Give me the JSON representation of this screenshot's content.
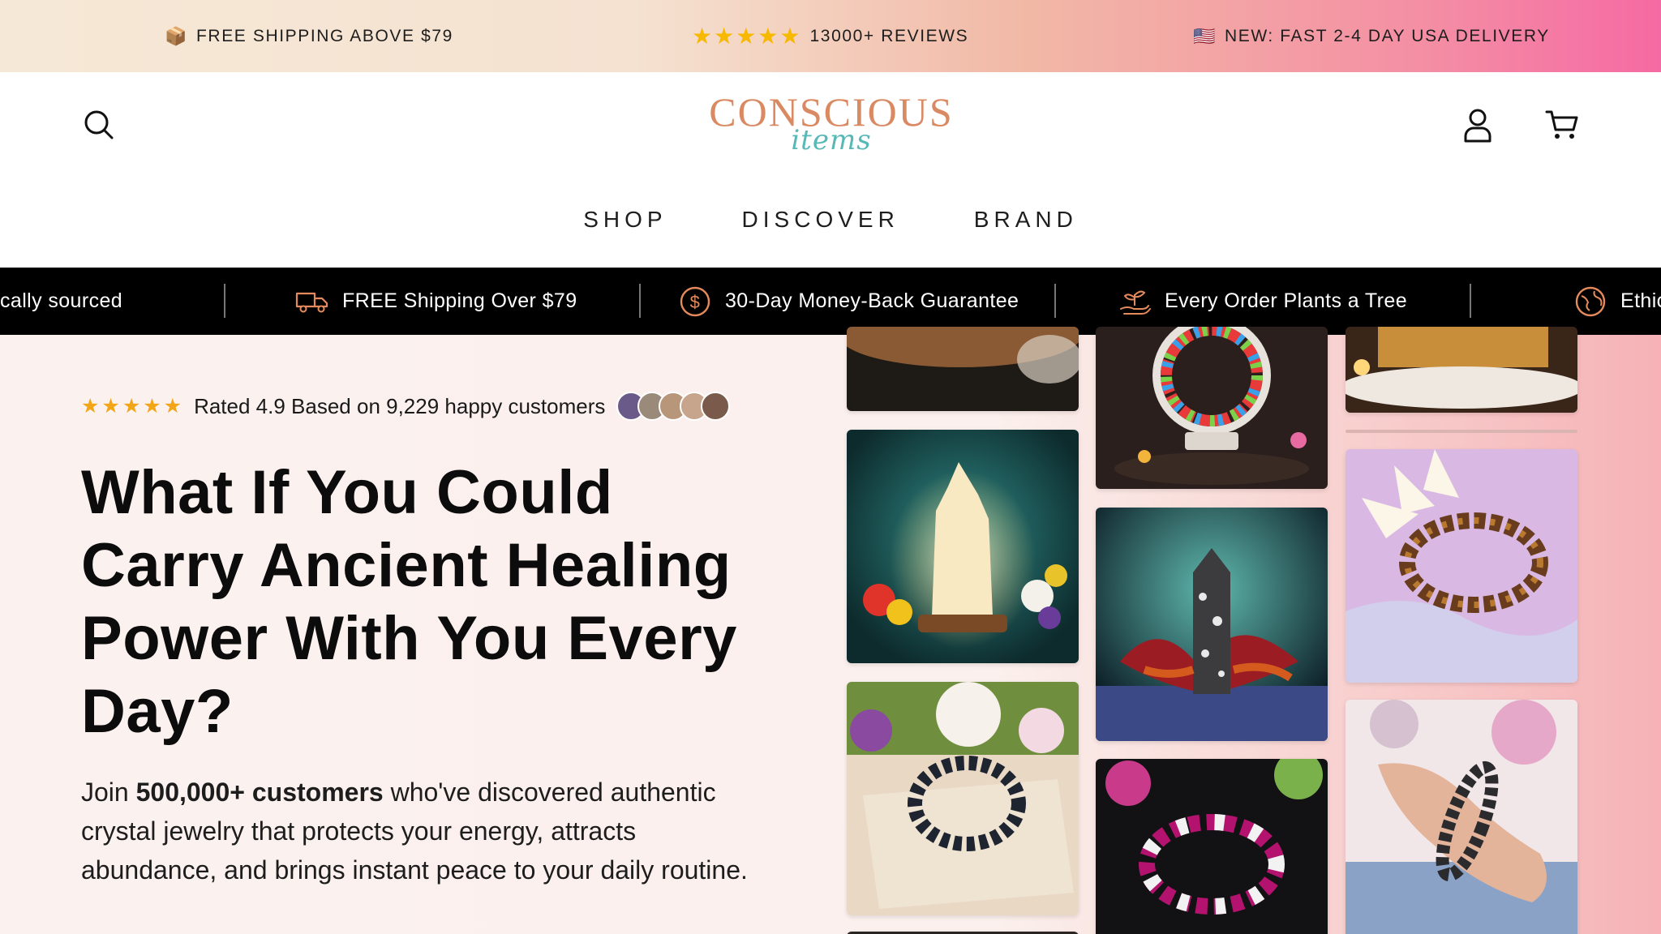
{
  "announcement": {
    "shipping": "FREE SHIPPING ABOVE $79",
    "shipping_icon": "package-icon",
    "stars": "★★★★★",
    "reviews": "13000+ REVIEWS",
    "delivery": "NEW: FAST 2-4 DAY USA DELIVERY",
    "delivery_icon": "us-flag-icon"
  },
  "header": {
    "logo_main": "CONSCIOUS",
    "logo_script": "items",
    "brand_color": "#d98a62",
    "script_color": "#57b8b5"
  },
  "nav": {
    "items": [
      "SHOP",
      "DISCOVER",
      "BRAND"
    ]
  },
  "ticker": {
    "items": [
      {
        "label": "cally sourced",
        "icon": "leaf-icon"
      },
      {
        "label": "FREE Shipping Over $79",
        "icon": "truck-icon"
      },
      {
        "label": "30-Day Money-Back Guarantee",
        "icon": "dollar-badge-icon"
      },
      {
        "label": "Every Order Plants a Tree",
        "icon": "plant-hand-icon"
      },
      {
        "label": "Ethic",
        "icon": "globe-icon"
      }
    ]
  },
  "hero": {
    "stars": "★★★★★",
    "rating_text": "Rated 4.9 Based on 9,229 happy customers",
    "headline": "What If You Could Carry Ancient Healing Power With You Every Day?",
    "sub_pre": "Join ",
    "sub_bold": "500,000+ customers",
    "sub_post": " who've discovered authentic crystal jewelry that protects your energy, attracts abundance, and brings instant peace to your daily routine."
  },
  "colors": {
    "star": "#f2a516",
    "ticker_bg": "#000000",
    "hero_bg": "#fbf1ee"
  }
}
